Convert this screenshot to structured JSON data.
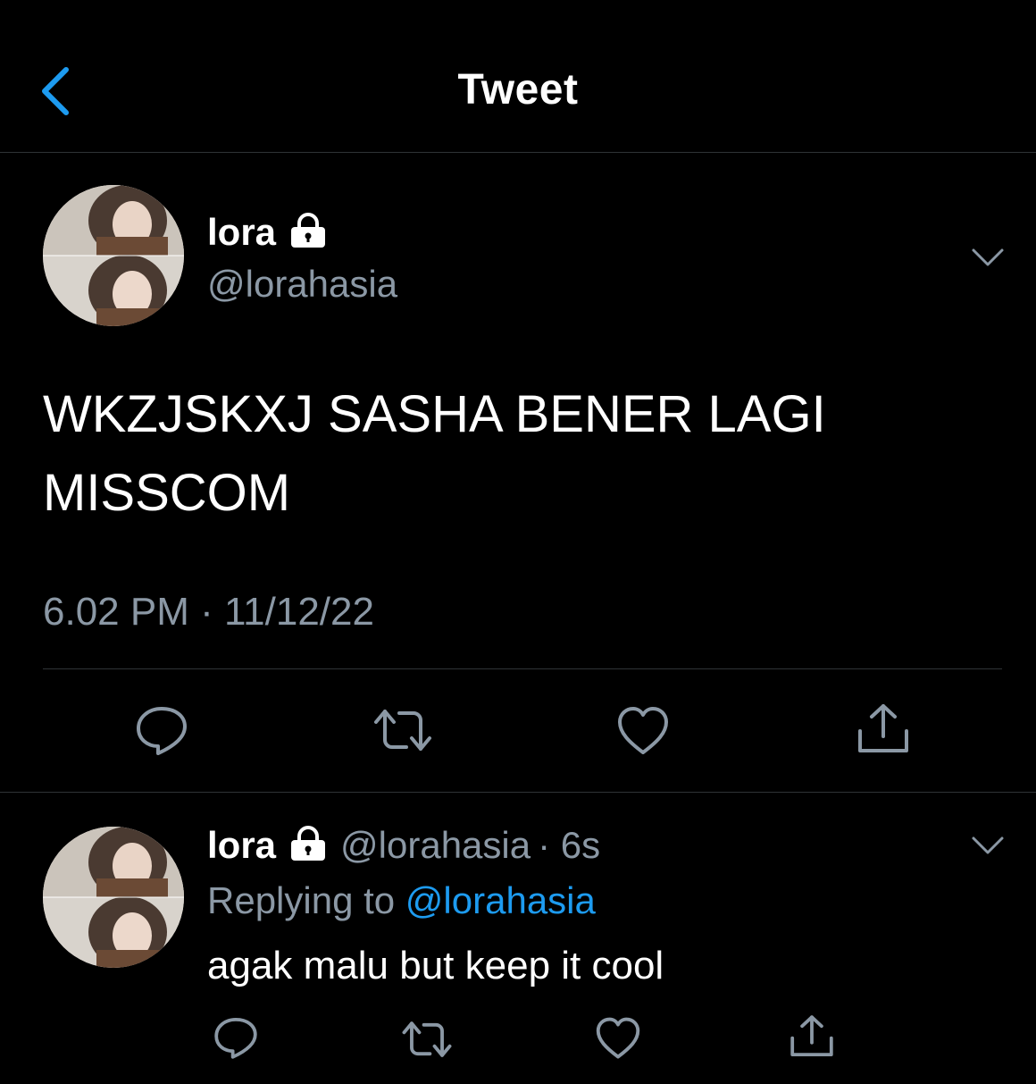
{
  "header": {
    "title": "Tweet",
    "back_icon": "chevron-left-icon",
    "accent": "#1d9bf0"
  },
  "tweet": {
    "author_name": "lora",
    "author_handle": "@lorahasia",
    "text": "WKZJSKXJ SASHA BENER LAGI MISSCOM",
    "timestamp": "6.02 PM · 11/12/22"
  },
  "reply": {
    "author_name": "lora",
    "author_handle": "@lorahasia",
    "age": "· 6s",
    "replying_prefix": "Replying to",
    "replying_handle": "@lorahasia",
    "text": "agak malu but keep it cool"
  },
  "colors": {
    "background": "#000000",
    "secondary_text": "#8b98a5",
    "divider": "#2f3336",
    "link": "#1d9bf0"
  }
}
